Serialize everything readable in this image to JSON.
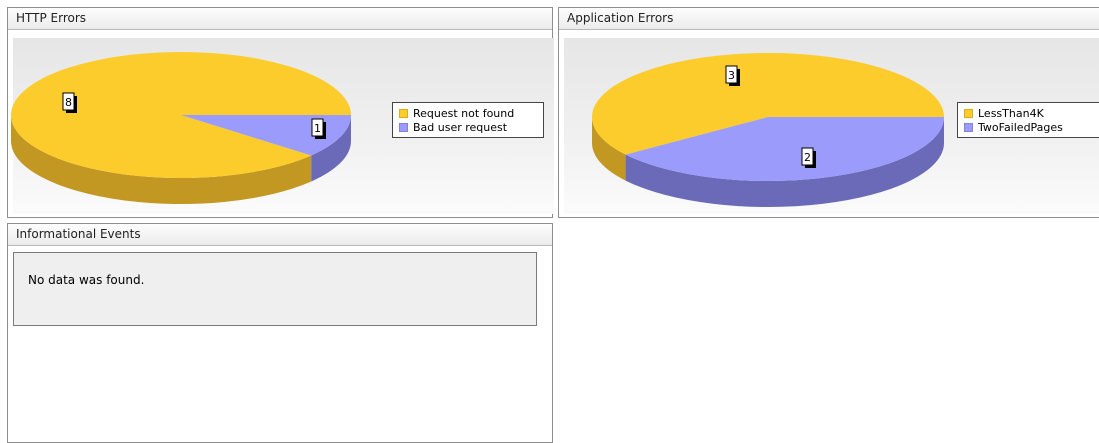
{
  "colors": {
    "yellow": "#fccc2c",
    "yellow_side": "#c29722",
    "blue": "#9b9bfb",
    "blue_side": "#6a6ab8"
  },
  "panels": {
    "http_errors": {
      "title": "HTTP Errors",
      "legend": [
        {
          "label": "Request not found",
          "color": "#fccc2c"
        },
        {
          "label": "Bad user request",
          "color": "#9b9bfb"
        }
      ]
    },
    "app_errors": {
      "title": "Application Errors",
      "legend": [
        {
          "label": "LessThan4K",
          "color": "#fccc2c"
        },
        {
          "label": "TwoFailedPages",
          "color": "#9b9bfb"
        }
      ]
    },
    "info_events": {
      "title": "Informational Events",
      "message": "No data was found."
    }
  },
  "chart_data": [
    {
      "type": "pie",
      "title": "HTTP Errors",
      "categories": [
        "Request not found",
        "Bad user request"
      ],
      "values": [
        8,
        1
      ],
      "data_labels": [
        "8",
        "1"
      ],
      "legend_position": "right"
    },
    {
      "type": "pie",
      "title": "Application Errors",
      "categories": [
        "LessThan4K",
        "TwoFailedPages"
      ],
      "values": [
        3,
        2
      ],
      "data_labels": [
        "3",
        "2"
      ],
      "legend_position": "right"
    }
  ]
}
